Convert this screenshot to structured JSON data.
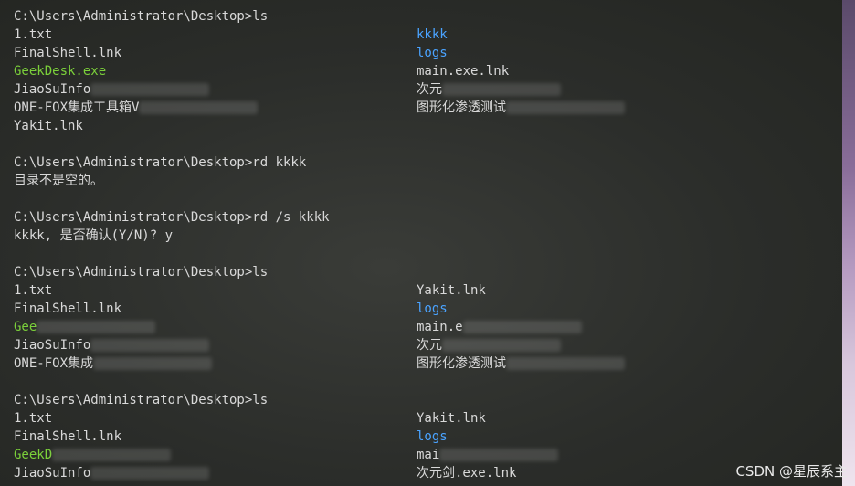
{
  "terminal": {
    "lines": [
      {
        "left": "C:\\Users\\Administrator\\Desktop>ls",
        "right": ""
      },
      {
        "left": "1.txt",
        "right": "kkkk",
        "right_type": "dir"
      },
      {
        "left": "FinalShell.lnk",
        "right": "logs",
        "right_type": "dir"
      },
      {
        "left": "GeekDesk.exe",
        "left_type": "exe",
        "right": "main.exe.lnk"
      },
      {
        "left": "JiaoSuInfo",
        "left_blur": true,
        "right": "次元",
        "right_blur": true
      },
      {
        "left": "ONE-FOX集成工具箱V",
        "left_blur": true,
        "right": "图形化渗透测试",
        "right_blur": true
      },
      {
        "left": "Yakit.lnk",
        "right": ""
      },
      {
        "left": "",
        "right": ""
      },
      {
        "left": "C:\\Users\\Administrator\\Desktop>rd kkkk",
        "right": ""
      },
      {
        "left": "目录不是空的。",
        "right": ""
      },
      {
        "left": "",
        "right": ""
      },
      {
        "left": "C:\\Users\\Administrator\\Desktop>rd /s kkkk",
        "right": ""
      },
      {
        "left": "kkkk, 是否确认(Y/N)? y",
        "right": ""
      },
      {
        "left": "",
        "right": ""
      },
      {
        "left": "C:\\Users\\Administrator\\Desktop>ls",
        "right": ""
      },
      {
        "left": "1.txt",
        "right": "Yakit.lnk"
      },
      {
        "left": "FinalShell.lnk",
        "right": "logs",
        "right_type": "dir"
      },
      {
        "left": "Gee",
        "left_type": "exe",
        "left_blur": true,
        "right": "main.e",
        "right_blur": true
      },
      {
        "left": "JiaoSuInfo",
        "left_blur": true,
        "right": "次元",
        "right_blur": true
      },
      {
        "left": "ONE-FOX集成",
        "left_blur": true,
        "right": "图形化渗透测试",
        "right_blur": true
      },
      {
        "left": "",
        "right": ""
      },
      {
        "left": "C:\\Users\\Administrator\\Desktop>ls",
        "right": ""
      },
      {
        "left": "1.txt",
        "right": "Yakit.lnk"
      },
      {
        "left": "FinalShell.lnk",
        "right": "logs",
        "right_type": "dir"
      },
      {
        "left": "GeekD",
        "left_type": "exe",
        "left_blur": true,
        "right": "mai",
        "right_blur": true
      },
      {
        "left": "JiaoSuInfo",
        "left_blur": true,
        "right": "次元剑.exe.lnk"
      }
    ]
  },
  "watermark": "CSDN @星辰系主"
}
